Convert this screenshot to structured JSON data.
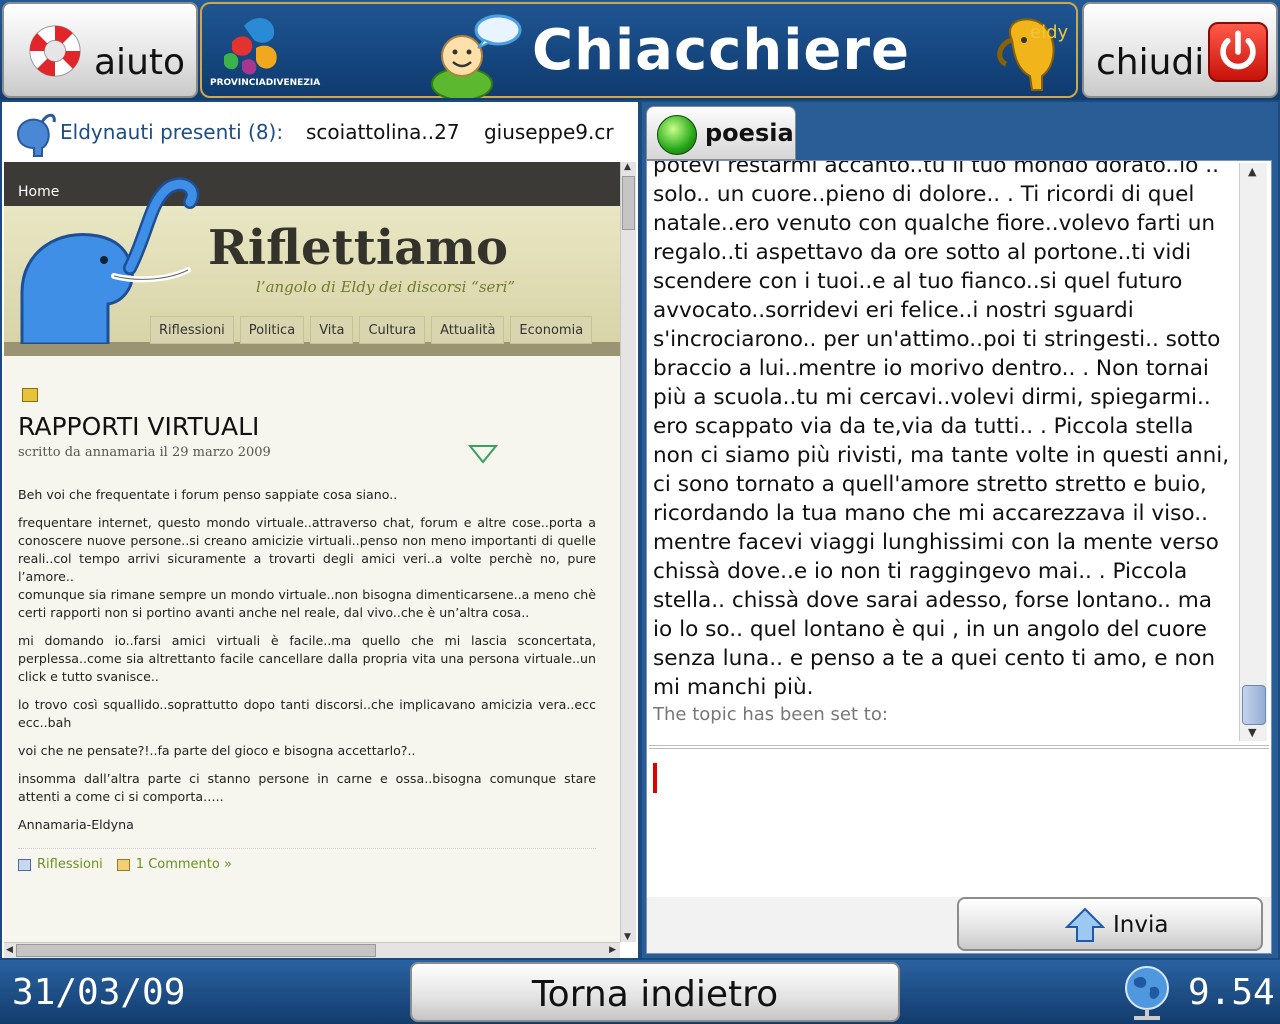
{
  "header": {
    "help_label": "aiuto",
    "title": "Chiacchiere",
    "close_label": "chiudi",
    "province_logo_text": "PROVINCIADIVENEZIA",
    "eldy_logo_text": "eldy"
  },
  "presence": {
    "label": "Eldynauti presenti (8):",
    "users": [
      "scoiattolina..27",
      "giuseppe9.cr"
    ]
  },
  "website": {
    "home_link": "Home",
    "site_title": "Riflettiamo",
    "site_subtitle": "l’angolo di Eldy dei discorsi “seri”",
    "nav": [
      "Riflessioni",
      "Politica",
      "Vita",
      "Cultura",
      "Attualità",
      "Economia"
    ],
    "post": {
      "title": "RAPPORTI VIRTUALI",
      "byline": "scritto da annamaria il 29 marzo 2009",
      "paragraphs": [
        "Beh voi che frequentate i forum penso sappiate cosa siano..",
        "frequentare internet, questo mondo virtuale..attraverso chat, forum e altre cose..porta a conoscere nuove persone..si creano amicizie virtuali..penso non meno importanti di quelle reali..col tempo arrivi sicuramente a trovarti degli amici veri..a volte perchè no, pure l’amore..",
        "comunque sia rimane sempre un mondo virtuale..non bisogna dimenticarsene..a meno chè certi rapporti non si portino avanti anche nel reale, dal vivo..che è un’altra cosa..",
        "mi domando io..farsi amici virtuali è facile..ma quello che mi lascia sconcertata, perplessa..come sia altrettanto facile cancellare dalla propria vita una persona virtuale..un click e tutto svanisce..",
        "lo trovo così squallido..soprattutto dopo tanti discorsi..che implicavano amicizia vera..ecc ecc..bah",
        "voi che ne pensate?!..fa parte del gioco e bisogna accettarlo?..",
        "insomma dall’altra parte ci stanno persone in carne e ossa..bisogna comunque stare attenti a come ci si comporta…..",
        "Annamaria-Eldyna"
      ],
      "category": "Riflessioni",
      "comments": "1 Commento »"
    }
  },
  "chat": {
    "tab_label": "poesia",
    "message": "potevi restarmi accanto..tu il tuo mondo dorato..io .. solo.. un cuore..pieno di dolore.. . Ti ricordi di quel natale..ero venuto con qualche fiore..volevo farti un regalo..ti aspettavo da ore sotto al portone..ti vidi scendere con i tuoi..e al tuo fianco..si quel futuro avvocato..sorridevi eri felice..i nostri sguardi s'incrociarono.. per un'attimo..poi ti stringesti.. sotto braccio a lui..mentre io morivo dentro.. . Non tornai più a scuola..tu mi cercavi..volevi dirmi, spiegarmi.. ero scappato via da te,via da tutti.. . Piccola stella non ci siamo più rivisti, ma tante volte in questi anni, ci sono tornato a quell'amore stretto stretto e buio, ricordando la tua mano che mi accarezzava il viso.. mentre facevi viaggi lunghissimi con la mente verso chissà dove..e io non ti raggingevo mai.. . Piccola stella.. chissà dove sarai adesso, forse lontano.. ma io lo so.. quel lontano è qui , in un angolo del cuore senza luna.. e penso a te  a quei cento ti amo, e non mi manchi più.",
    "topic": "The topic has been set to:",
    "input_value": "",
    "send_label": "Invia"
  },
  "footer": {
    "date": "31/03/09",
    "back_label": "Torna indietro",
    "time": "9.54"
  },
  "colors": {
    "header_blue": "#1b4a80",
    "accent_gold": "#c9a94a",
    "online_green": "#27a81a",
    "caret_red": "#e00000"
  }
}
